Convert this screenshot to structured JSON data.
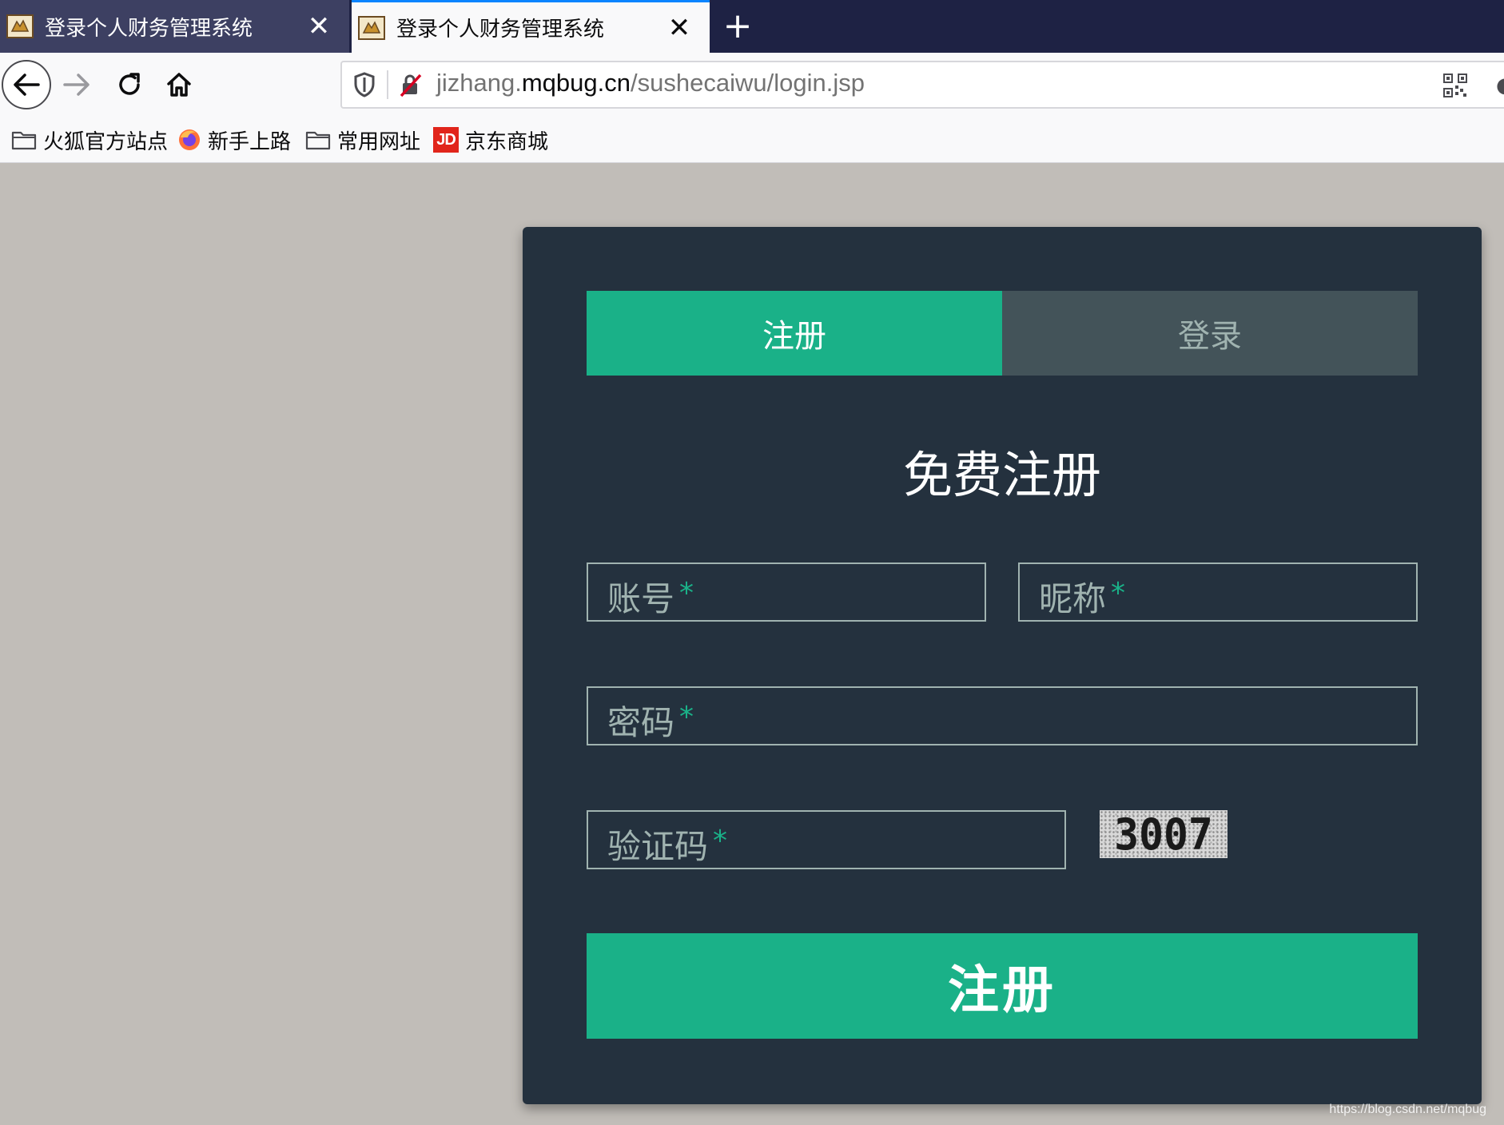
{
  "browser": {
    "tabs": [
      {
        "title": "登录个人财务管理系统",
        "close": "✕",
        "active": false
      },
      {
        "title": "登录个人财务管理系统",
        "close": "✕",
        "active": true
      }
    ],
    "new_tab_label": "+",
    "url": {
      "prefix": "jizhang.",
      "domain": "mqbug.cn",
      "path": "/sushecaiwu/login.jsp"
    },
    "bookmarks": [
      {
        "label": "火狐官方站点",
        "icon": "folder-icon"
      },
      {
        "label": "新手上路",
        "icon": "firefox-icon"
      },
      {
        "label": "常用网址",
        "icon": "folder-icon"
      },
      {
        "label": "京东商城",
        "icon": "jd-icon",
        "icon_text": "JD"
      }
    ]
  },
  "form": {
    "tabs": {
      "register": "注册",
      "login": "登录"
    },
    "heading": "免费注册",
    "fields": {
      "account": {
        "placeholder": "账号",
        "required_mark": "*"
      },
      "nickname": {
        "placeholder": "昵称",
        "required_mark": "*"
      },
      "password": {
        "placeholder": "密码",
        "required_mark": "*"
      },
      "captcha": {
        "placeholder": "验证码",
        "required_mark": "*"
      }
    },
    "captcha_image_text": "3007",
    "submit_label": "注册"
  },
  "watermark": "https://blog.csdn.net/mqbug",
  "colors": {
    "accent": "#1ab188",
    "card_bg": "#24313e",
    "inactive_tab": "#435359",
    "page_bg": "#c1bdb8"
  }
}
